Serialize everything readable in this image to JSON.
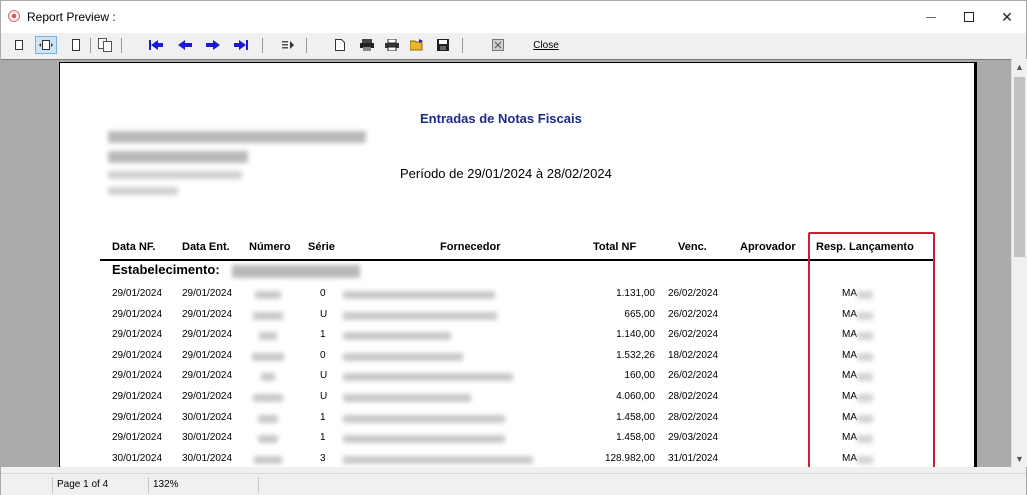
{
  "window": {
    "title": "Report Preview :"
  },
  "toolbar": {
    "close_label": "Close"
  },
  "report": {
    "title": "Entradas de Notas Fiscais",
    "period": "Período de 29/01/2024 à 28/02/2024",
    "columns": [
      "Data NF.",
      "Data Ent.",
      "Número",
      "Série",
      "Fornecedor",
      "Total NF",
      "Venc.",
      "Aprovador",
      "Resp. Lançamento"
    ],
    "establishment_label": "Estabelecimento:",
    "rows": [
      {
        "data_nf": "29/01/2024",
        "data_ent": "29/01/2024",
        "serie": "0",
        "total": "1.131,00",
        "venc": "26/02/2024",
        "resp": "MA"
      },
      {
        "data_nf": "29/01/2024",
        "data_ent": "29/01/2024",
        "serie": "U",
        "total": "665,00",
        "venc": "26/02/2024",
        "resp": "MA"
      },
      {
        "data_nf": "29/01/2024",
        "data_ent": "29/01/2024",
        "serie": "1",
        "total": "1.140,00",
        "venc": "26/02/2024",
        "resp": "MA"
      },
      {
        "data_nf": "29/01/2024",
        "data_ent": "29/01/2024",
        "serie": "0",
        "total": "1.532,26",
        "venc": "18/02/2024",
        "resp": "MA"
      },
      {
        "data_nf": "29/01/2024",
        "data_ent": "29/01/2024",
        "serie": "U",
        "total": "160,00",
        "venc": "26/02/2024",
        "resp": "MA"
      },
      {
        "data_nf": "29/01/2024",
        "data_ent": "29/01/2024",
        "serie": "U",
        "total": "4.060,00",
        "venc": "28/02/2024",
        "resp": "MA"
      },
      {
        "data_nf": "29/01/2024",
        "data_ent": "30/01/2024",
        "serie": "1",
        "total": "1.458,00",
        "venc": "28/02/2024",
        "resp": "MA"
      },
      {
        "data_nf": "29/01/2024",
        "data_ent": "30/01/2024",
        "serie": "1",
        "total": "1.458,00",
        "venc": "29/03/2024",
        "resp": "MA"
      },
      {
        "data_nf": "30/01/2024",
        "data_ent": "30/01/2024",
        "serie": "3",
        "total": "128.982,00",
        "venc": "31/01/2024",
        "resp": "MA"
      }
    ]
  },
  "status": {
    "page": "Page 1 of 4",
    "zoom": "132%"
  },
  "colors": {
    "title_blue": "#1b2a8c",
    "toolbar_arrow": "#1a1ad8",
    "highlight": "#d21e2a"
  }
}
